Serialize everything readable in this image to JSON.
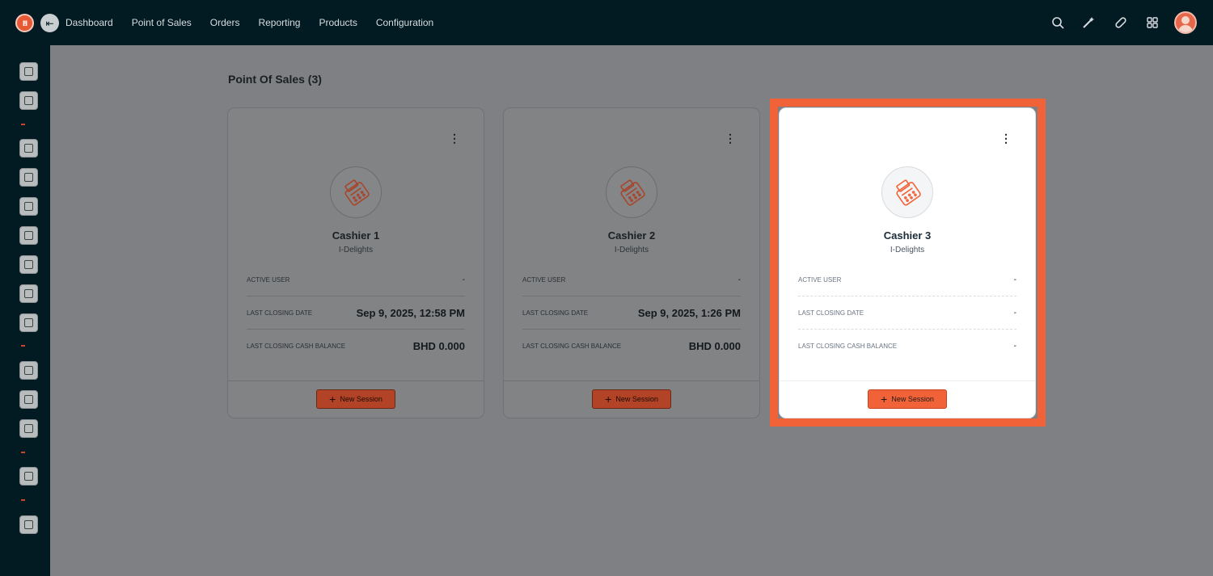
{
  "header": {
    "logo_text": "I!I",
    "nav": [
      "Dashboard",
      "Point of Sales",
      "Orders",
      "Reporting",
      "Products",
      "Configuration"
    ],
    "icons": [
      "search-icon",
      "magic-wand-icon",
      "pill-icon",
      "apps-grid-icon",
      "user-avatar"
    ]
  },
  "sidebar": {
    "icons": [
      "clipboard-icon",
      "chart-board-icon",
      "money-hand-icon",
      "bar-chart-icon",
      "book-icon",
      "clipboard-list-icon",
      "box-icon",
      "ticket-icon",
      "search-report-icon",
      "headset-icon",
      "folder-icon",
      "safe-icon",
      "settings-icon",
      "logout-icon"
    ]
  },
  "main": {
    "title": "Point Of Sales (3)",
    "cards": [
      {
        "name": "Cashier 1",
        "subtitle": "I-Delights",
        "active_user_label": "ACTIVE USER",
        "active_user": "-",
        "last_closing_date_label": "LAST CLOSING DATE",
        "last_closing_date": "Sep 9, 2025, 12:58 PM",
        "last_closing_cash_label": "LAST CLOSING CASH BALANCE",
        "last_closing_cash": "BHD 0.000",
        "button": "New Session"
      },
      {
        "name": "Cashier 2",
        "subtitle": "I-Delights",
        "active_user_label": "ACTIVE USER",
        "active_user": "-",
        "last_closing_date_label": "LAST CLOSING DATE",
        "last_closing_date": "Sep 9, 2025, 1:26 PM",
        "last_closing_cash_label": "LAST CLOSING CASH BALANCE",
        "last_closing_cash": "BHD 0.000",
        "button": "New Session"
      },
      {
        "name": "Cashier 3",
        "subtitle": "I-Delights",
        "active_user_label": "ACTIVE USER",
        "active_user": "-",
        "last_closing_date_label": "LAST CLOSING DATE",
        "last_closing_date": "-",
        "last_closing_cash_label": "LAST CLOSING CASH BALANCE",
        "last_closing_cash": "-",
        "button": "New Session"
      }
    ]
  },
  "colors": {
    "topbar": "#021a22",
    "accent": "#f26238",
    "overlay": "#7e8083"
  }
}
